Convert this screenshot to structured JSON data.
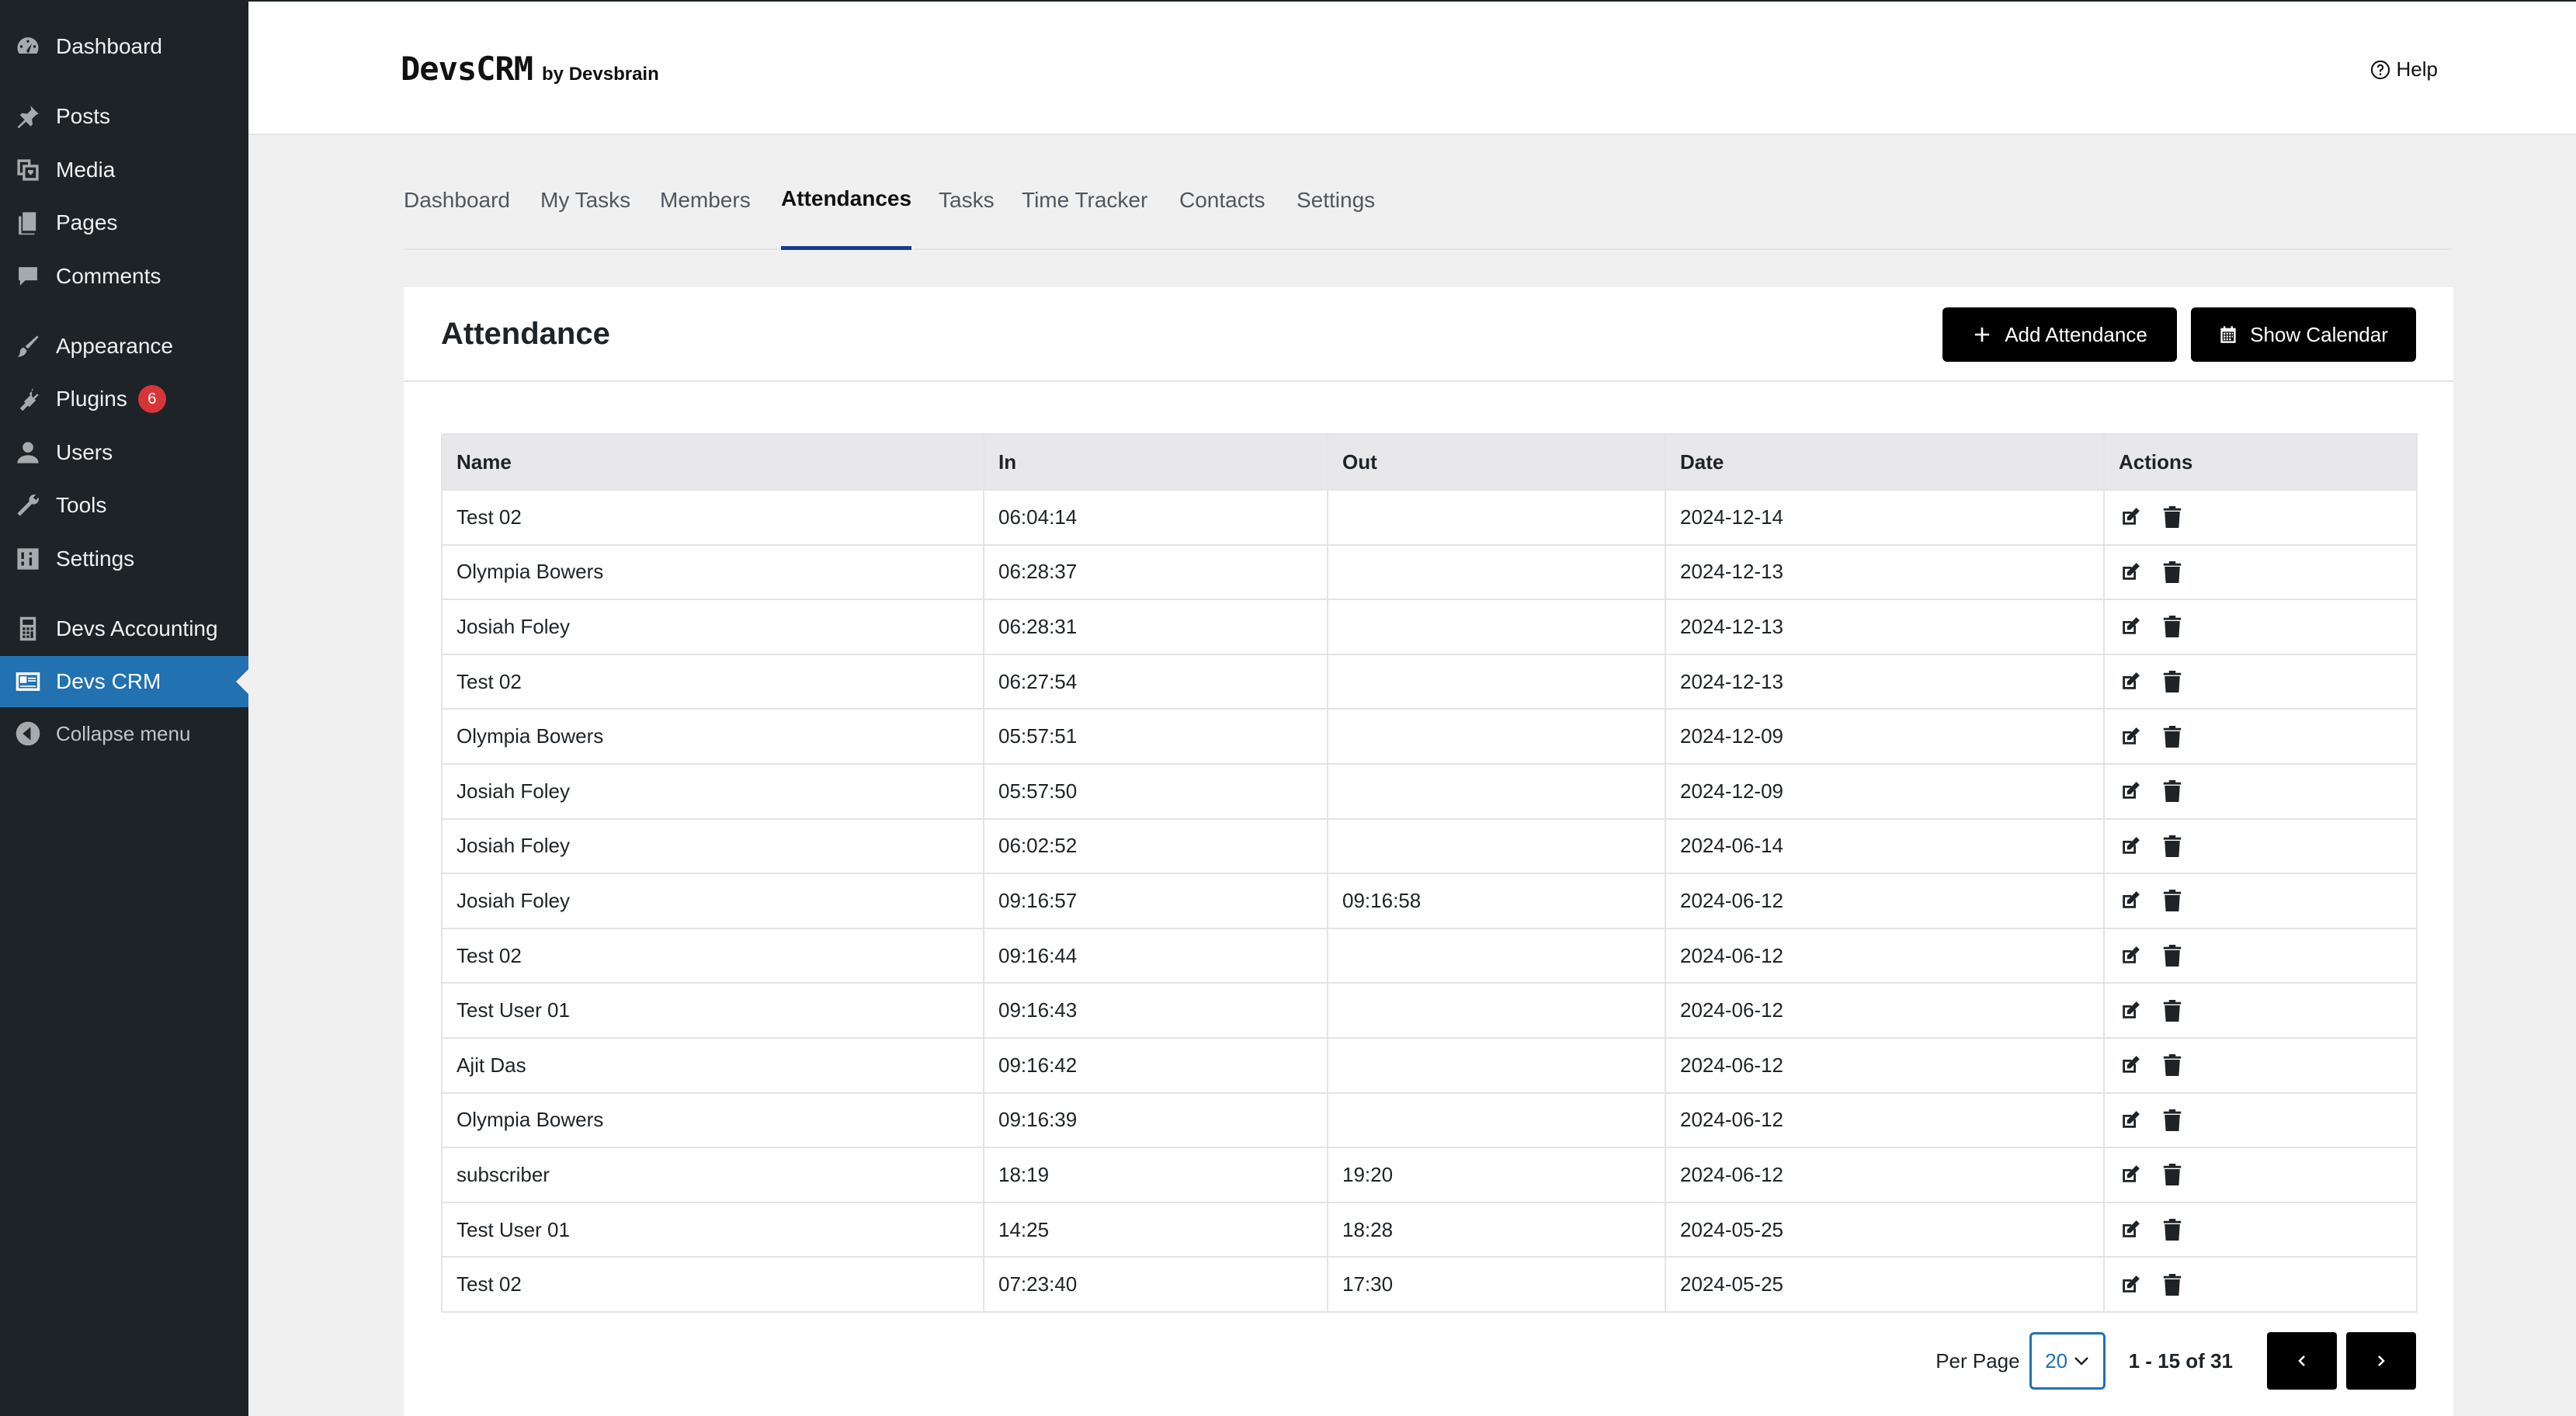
{
  "sidebar": {
    "items": [
      {
        "label": "Dashboard",
        "icon": "dashboard-icon"
      },
      {
        "label": "Posts",
        "icon": "pin-icon"
      },
      {
        "label": "Media",
        "icon": "media-icon"
      },
      {
        "label": "Pages",
        "icon": "pages-icon"
      },
      {
        "label": "Comments",
        "icon": "comment-icon"
      },
      {
        "label": "Appearance",
        "icon": "brush-icon"
      },
      {
        "label": "Plugins",
        "icon": "plugin-icon",
        "badge": "6"
      },
      {
        "label": "Users",
        "icon": "user-icon"
      },
      {
        "label": "Tools",
        "icon": "wrench-icon"
      },
      {
        "label": "Settings",
        "icon": "sliders-icon"
      },
      {
        "label": "Devs Accounting",
        "icon": "calculator-icon"
      },
      {
        "label": "Devs CRM",
        "icon": "id-card-icon",
        "current": true
      },
      {
        "label": "Collapse menu",
        "icon": "collapse-icon"
      }
    ]
  },
  "header": {
    "brand": "DevsCRM",
    "brand_by": "by Devsbrain",
    "help": "Help"
  },
  "tabs": [
    {
      "label": "Dashboard"
    },
    {
      "label": "My Tasks"
    },
    {
      "label": "Members"
    },
    {
      "label": "Attendances",
      "active": true
    },
    {
      "label": "Tasks"
    },
    {
      "label": "Time Tracker"
    },
    {
      "label": "Contacts"
    },
    {
      "label": "Settings"
    }
  ],
  "card": {
    "title": "Attendance",
    "add_button": "Add Attendance",
    "calendar_button": "Show Calendar"
  },
  "table": {
    "columns": [
      "Name",
      "In",
      "Out",
      "Date",
      "Actions"
    ],
    "rows": [
      {
        "name": "Test 02",
        "in": "06:04:14",
        "out": "",
        "date": "2024-12-14"
      },
      {
        "name": "Olympia Bowers",
        "in": "06:28:37",
        "out": "",
        "date": "2024-12-13"
      },
      {
        "name": "Josiah Foley",
        "in": "06:28:31",
        "out": "",
        "date": "2024-12-13"
      },
      {
        "name": "Test 02",
        "in": "06:27:54",
        "out": "",
        "date": "2024-12-13"
      },
      {
        "name": "Olympia Bowers",
        "in": "05:57:51",
        "out": "",
        "date": "2024-12-09"
      },
      {
        "name": "Josiah Foley",
        "in": "05:57:50",
        "out": "",
        "date": "2024-12-09"
      },
      {
        "name": "Josiah Foley",
        "in": "06:02:52",
        "out": "",
        "date": "2024-06-14"
      },
      {
        "name": "Josiah Foley",
        "in": "09:16:57",
        "out": "09:16:58",
        "date": "2024-06-12"
      },
      {
        "name": "Test 02",
        "in": "09:16:44",
        "out": "",
        "date": "2024-06-12"
      },
      {
        "name": "Test User 01",
        "in": "09:16:43",
        "out": "",
        "date": "2024-06-12"
      },
      {
        "name": "Ajit Das",
        "in": "09:16:42",
        "out": "",
        "date": "2024-06-12"
      },
      {
        "name": "Olympia Bowers",
        "in": "09:16:39",
        "out": "",
        "date": "2024-06-12"
      },
      {
        "name": "subscriber",
        "in": "18:19",
        "out": "19:20",
        "date": "2024-06-12"
      },
      {
        "name": "Test User 01",
        "in": "14:25",
        "out": "18:28",
        "date": "2024-05-25"
      },
      {
        "name": "Test 02",
        "in": "07:23:40",
        "out": "17:30",
        "date": "2024-05-25"
      }
    ]
  },
  "pagination": {
    "per_page_label": "Per Page",
    "per_page_value": "20",
    "range": "1 - 15 of 31",
    "prev_icon": "chevron-left-icon",
    "next_icon": "chevron-right-icon"
  },
  "colors": {
    "sidebar_bg": "#1d2327",
    "sidebar_active": "#2271b1",
    "badge": "#d63638",
    "tab_underline": "#1e3a8a",
    "button_bg": "#000000"
  }
}
